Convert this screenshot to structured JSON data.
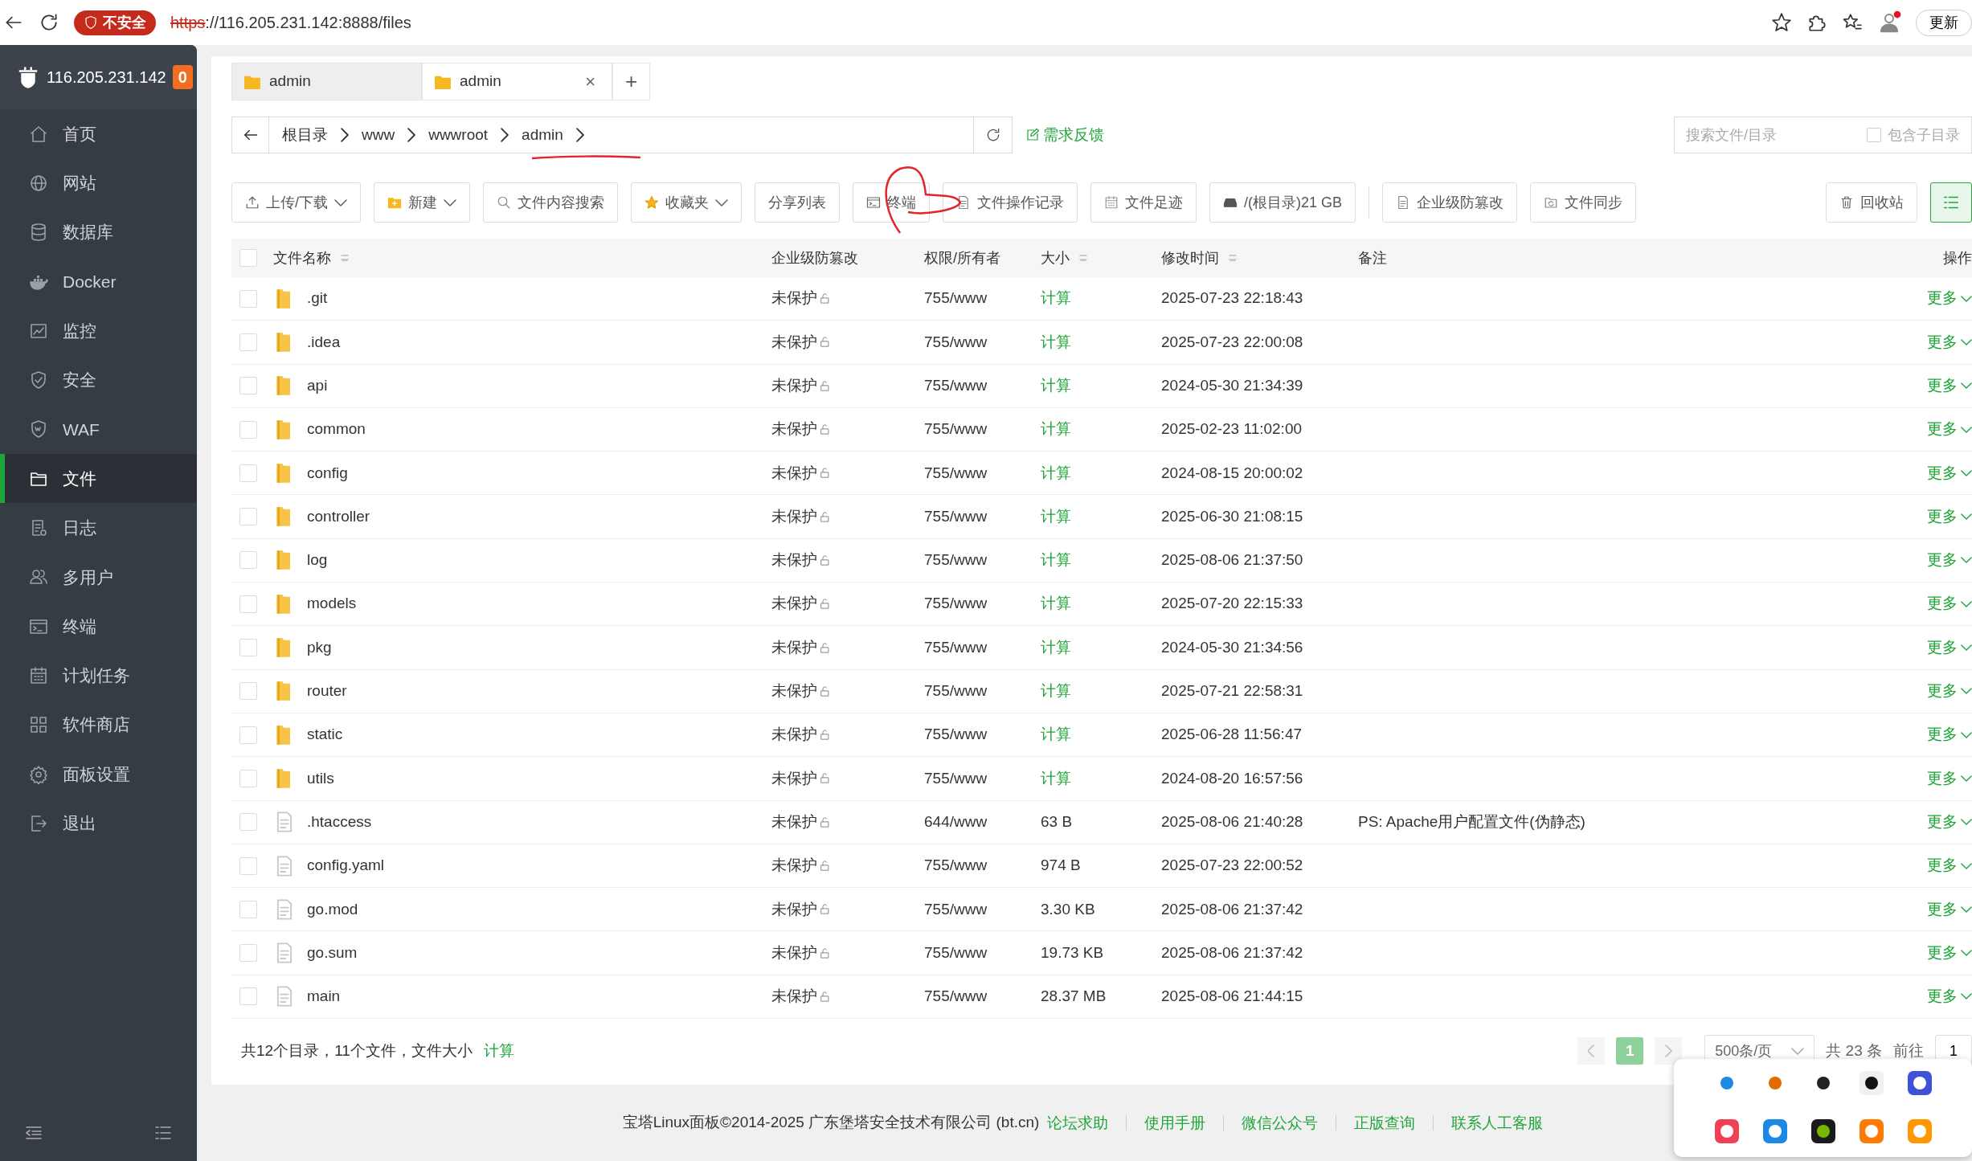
{
  "browser": {
    "security_label": "不安全",
    "url_scheme": "https",
    "url_rest": "://116.205.231.142:8888/files",
    "update_button": "更新"
  },
  "sidebar": {
    "server": "116.205.231.142",
    "badge": "0",
    "items": [
      {
        "label": "首页",
        "selected": false
      },
      {
        "label": "网站",
        "selected": false
      },
      {
        "label": "数据库",
        "selected": false
      },
      {
        "label": "Docker",
        "selected": false
      },
      {
        "label": "监控",
        "selected": false
      },
      {
        "label": "安全",
        "selected": false
      },
      {
        "label": "WAF",
        "selected": false
      },
      {
        "label": "文件",
        "selected": true
      },
      {
        "label": "日志",
        "selected": false
      },
      {
        "label": "多用户",
        "selected": false
      },
      {
        "label": "终端",
        "selected": false
      },
      {
        "label": "计划任务",
        "selected": false
      },
      {
        "label": "软件商店",
        "selected": false
      },
      {
        "label": "面板设置",
        "selected": false
      },
      {
        "label": "退出",
        "selected": false
      }
    ]
  },
  "tabs": [
    {
      "label": "admin",
      "selected": false
    },
    {
      "label": "admin",
      "selected": true,
      "close": "×"
    }
  ],
  "new_tab": "+",
  "breadcrumb": [
    "根目录",
    "www",
    "wwwroot",
    "admin"
  ],
  "feedback_link": "需求反馈",
  "search": {
    "placeholder": "搜索文件/目录",
    "include_subdirs": {
      "label": "包含子目录",
      "checked": false
    }
  },
  "toolbar": [
    {
      "label": "上传/下载",
      "dropdown": true
    },
    {
      "label": "新建",
      "dropdown": true
    },
    {
      "label": "文件内容搜索",
      "dropdown": false
    },
    {
      "label": "收藏夹",
      "dropdown": true
    },
    {
      "label": "分享列表",
      "dropdown": false
    },
    {
      "label": "终端",
      "dropdown": false
    },
    {
      "label": "文件操作记录",
      "dropdown": false
    },
    {
      "label": "文件足迹",
      "dropdown": false
    },
    {
      "label": "/(根目录)21 GB",
      "dropdown": false
    },
    {
      "label": "企业级防篡改",
      "dropdown": false
    },
    {
      "label": "文件同步",
      "dropdown": false
    }
  ],
  "recycle_button": "回收站",
  "table": {
    "select_all_checked": false,
    "columns": [
      "文件名称",
      "企业级防篡改",
      "权限/所有者",
      "大小",
      "修改时间",
      "备注",
      "操作"
    ],
    "rows": [
      {
        "kind": "folder",
        "name": ".git",
        "protection": "未保护",
        "permission": "755/www",
        "size": "计算",
        "modified": "2025-07-23 22:18:43",
        "note": "",
        "action": "更多",
        "checked": false
      },
      {
        "kind": "folder",
        "name": ".idea",
        "protection": "未保护",
        "permission": "755/www",
        "size": "计算",
        "modified": "2025-07-23 22:00:08",
        "note": "",
        "action": "更多",
        "checked": false
      },
      {
        "kind": "folder",
        "name": "api",
        "protection": "未保护",
        "permission": "755/www",
        "size": "计算",
        "modified": "2024-05-30 21:34:39",
        "note": "",
        "action": "更多",
        "checked": false
      },
      {
        "kind": "folder",
        "name": "common",
        "protection": "未保护",
        "permission": "755/www",
        "size": "计算",
        "modified": "2025-02-23 11:02:00",
        "note": "",
        "action": "更多",
        "checked": false
      },
      {
        "kind": "folder",
        "name": "config",
        "protection": "未保护",
        "permission": "755/www",
        "size": "计算",
        "modified": "2024-08-15 20:00:02",
        "note": "",
        "action": "更多",
        "checked": false
      },
      {
        "kind": "folder",
        "name": "controller",
        "protection": "未保护",
        "permission": "755/www",
        "size": "计算",
        "modified": "2025-06-30 21:08:15",
        "note": "",
        "action": "更多",
        "checked": false
      },
      {
        "kind": "folder",
        "name": "log",
        "protection": "未保护",
        "permission": "755/www",
        "size": "计算",
        "modified": "2025-08-06 21:37:50",
        "note": "",
        "action": "更多",
        "checked": false
      },
      {
        "kind": "folder",
        "name": "models",
        "protection": "未保护",
        "permission": "755/www",
        "size": "计算",
        "modified": "2025-07-20 22:15:33",
        "note": "",
        "action": "更多",
        "checked": false
      },
      {
        "kind": "folder",
        "name": "pkg",
        "protection": "未保护",
        "permission": "755/www",
        "size": "计算",
        "modified": "2024-05-30 21:34:56",
        "note": "",
        "action": "更多",
        "checked": false
      },
      {
        "kind": "folder",
        "name": "router",
        "protection": "未保护",
        "permission": "755/www",
        "size": "计算",
        "modified": "2025-07-21 22:58:31",
        "note": "",
        "action": "更多",
        "checked": false
      },
      {
        "kind": "folder",
        "name": "static",
        "protection": "未保护",
        "permission": "755/www",
        "size": "计算",
        "modified": "2025-06-28 11:56:47",
        "note": "",
        "action": "更多",
        "checked": false
      },
      {
        "kind": "folder",
        "name": "utils",
        "protection": "未保护",
        "permission": "755/www",
        "size": "计算",
        "modified": "2024-08-20 16:57:56",
        "note": "",
        "action": "更多",
        "checked": false
      },
      {
        "kind": "file",
        "name": ".htaccess",
        "protection": "未保护",
        "permission": "644/www",
        "size": "63 B",
        "modified": "2025-08-06 21:40:28",
        "note": "PS: Apache用户配置文件(伪静态)",
        "action": "更多",
        "checked": false
      },
      {
        "kind": "file",
        "name": "config.yaml",
        "protection": "未保护",
        "permission": "755/www",
        "size": "974 B",
        "modified": "2025-07-23 22:00:52",
        "note": "",
        "action": "更多",
        "checked": false
      },
      {
        "kind": "file",
        "name": "go.mod",
        "protection": "未保护",
        "permission": "755/www",
        "size": "3.30 KB",
        "modified": "2025-08-06 21:37:42",
        "note": "",
        "action": "更多",
        "checked": false
      },
      {
        "kind": "file",
        "name": "go.sum",
        "protection": "未保护",
        "permission": "755/www",
        "size": "19.73 KB",
        "modified": "2025-08-06 21:37:42",
        "note": "",
        "action": "更多",
        "checked": false
      },
      {
        "kind": "file",
        "name": "main",
        "protection": "未保护",
        "permission": "755/www",
        "size": "28.37 MB",
        "modified": "2025-08-06 21:44:15",
        "note": "",
        "action": "更多",
        "checked": false
      }
    ]
  },
  "summary": {
    "text": "共12个目录，11个文件，文件大小",
    "link": "计算"
  },
  "pagination": {
    "pages": [
      {
        "label": "1",
        "selected": true
      }
    ],
    "page_size": "500条/页",
    "total": "共 23 条",
    "goto_label": "前往",
    "goto_value": "1"
  },
  "footer": {
    "copyright": "宝塔Linux面板©2014-2025 广东堡塔安全技术有限公司 (bt.cn)",
    "links": [
      "论坛求助",
      "使用手册",
      "微信公众号",
      "正版查询",
      "联系人工客服"
    ]
  }
}
